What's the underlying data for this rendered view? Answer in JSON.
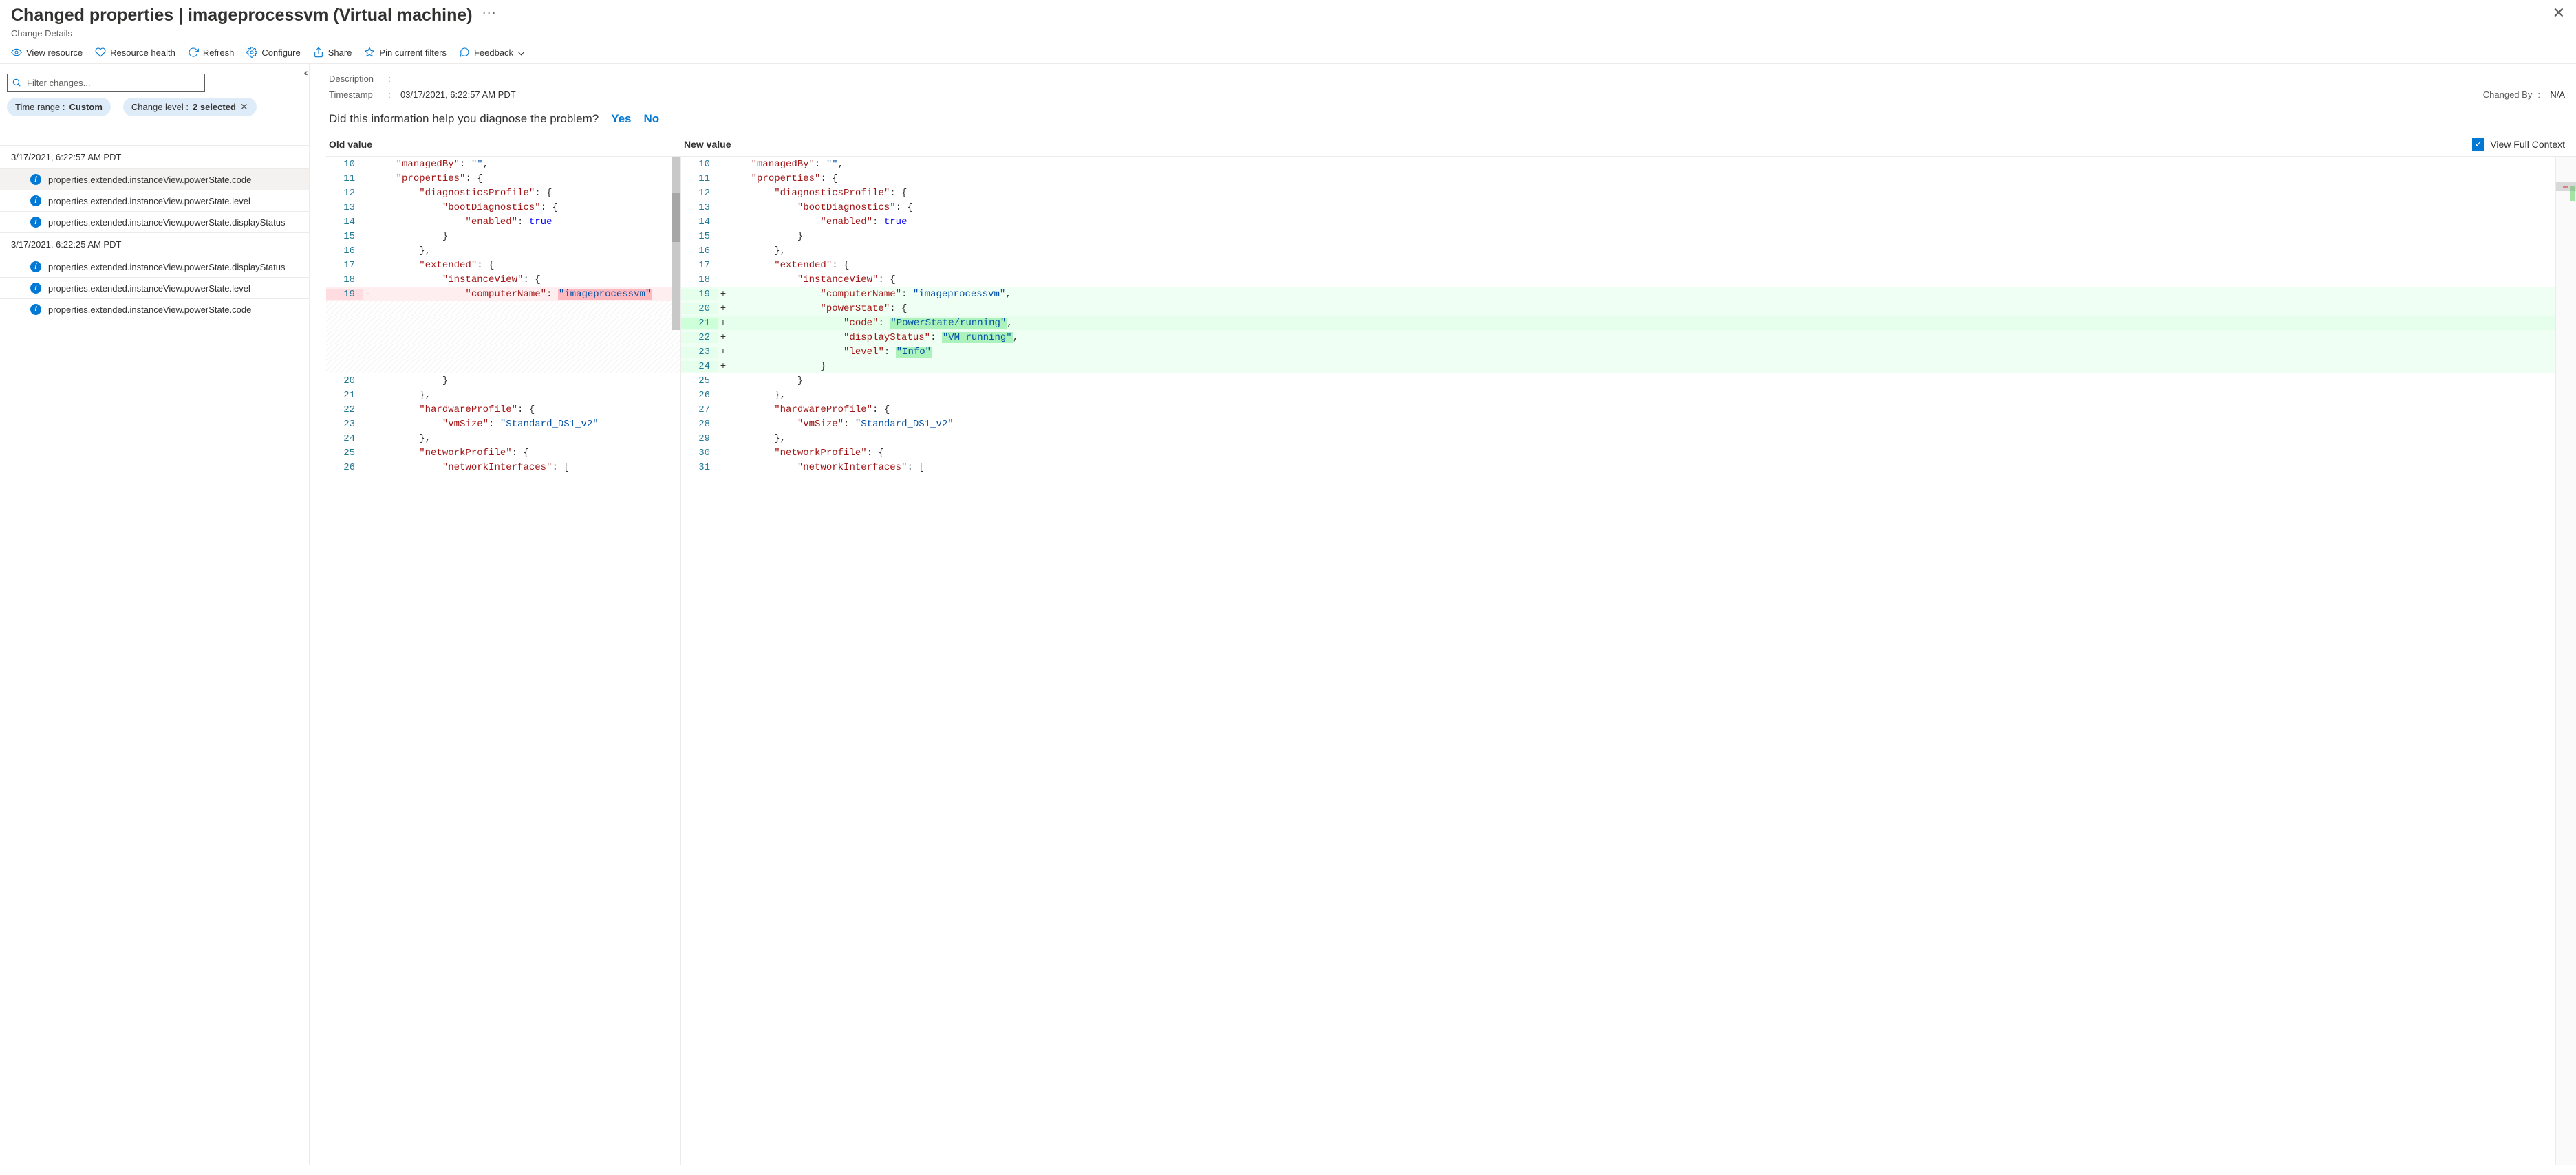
{
  "header": {
    "title": "Changed properties | imageprocessvm (Virtual machine)",
    "subtitle": "Change Details"
  },
  "toolbar": {
    "view_resource": "View resource",
    "resource_health": "Resource health",
    "refresh": "Refresh",
    "configure": "Configure",
    "share": "Share",
    "pin": "Pin current filters",
    "feedback": "Feedback"
  },
  "filter": {
    "placeholder": "Filter changes...",
    "time_range_label": "Time range : ",
    "time_range_value": "Custom",
    "change_level_label": "Change level : ",
    "change_level_value": "2 selected"
  },
  "groups": [
    {
      "timestamp": "3/17/2021, 6:22:57 AM PDT",
      "items": [
        {
          "path": "properties.extended.instanceView.powerState.code",
          "selected": true
        },
        {
          "path": "properties.extended.instanceView.powerState.level",
          "selected": false
        },
        {
          "path": "properties.extended.instanceView.powerState.displayStatus",
          "selected": false
        }
      ]
    },
    {
      "timestamp": "3/17/2021, 6:22:25 AM PDT",
      "items": [
        {
          "path": "properties.extended.instanceView.powerState.displayStatus",
          "selected": false
        },
        {
          "path": "properties.extended.instanceView.powerState.level",
          "selected": false
        },
        {
          "path": "properties.extended.instanceView.powerState.code",
          "selected": false
        }
      ]
    }
  ],
  "meta": {
    "description_label": "Description",
    "description_value": "",
    "timestamp_label": "Timestamp",
    "timestamp_value": "03/17/2021, 6:22:57 AM PDT",
    "changed_by_label": "Changed By",
    "changed_by_value": "N/A"
  },
  "prompt": {
    "question": "Did this information help you diagnose the problem?",
    "yes": "Yes",
    "no": "No"
  },
  "diff": {
    "old_label": "Old value",
    "new_label": "New value",
    "full_context_label": "View Full Context",
    "old_lines": [
      {
        "n": 10,
        "type": "normal",
        "tokens": [
          [
            "p",
            "    "
          ],
          [
            "k",
            "\"managedBy\""
          ],
          [
            "p",
            ": "
          ],
          [
            "s",
            "\"\""
          ],
          [
            "p",
            ","
          ]
        ]
      },
      {
        "n": 11,
        "type": "normal",
        "tokens": [
          [
            "p",
            "    "
          ],
          [
            "k",
            "\"properties\""
          ],
          [
            "p",
            ": {"
          ]
        ]
      },
      {
        "n": 12,
        "type": "normal",
        "tokens": [
          [
            "p",
            "        "
          ],
          [
            "k",
            "\"diagnosticsProfile\""
          ],
          [
            "p",
            ": {"
          ]
        ]
      },
      {
        "n": 13,
        "type": "normal",
        "tokens": [
          [
            "p",
            "            "
          ],
          [
            "k",
            "\"bootDiagnostics\""
          ],
          [
            "p",
            ": {"
          ]
        ]
      },
      {
        "n": 14,
        "type": "normal",
        "tokens": [
          [
            "p",
            "                "
          ],
          [
            "k",
            "\"enabled\""
          ],
          [
            "p",
            ": "
          ],
          [
            "b",
            "true"
          ]
        ]
      },
      {
        "n": 15,
        "type": "normal",
        "tokens": [
          [
            "p",
            "            }"
          ]
        ]
      },
      {
        "n": 16,
        "type": "normal",
        "tokens": [
          [
            "p",
            "        },"
          ]
        ]
      },
      {
        "n": 17,
        "type": "normal",
        "tokens": [
          [
            "p",
            "        "
          ],
          [
            "k",
            "\"extended\""
          ],
          [
            "p",
            ": {"
          ]
        ]
      },
      {
        "n": 18,
        "type": "normal",
        "tokens": [
          [
            "p",
            "            "
          ],
          [
            "k",
            "\"instanceView\""
          ],
          [
            "p",
            ": {"
          ]
        ]
      },
      {
        "n": 19,
        "type": "removed",
        "marker": "-",
        "tokens": [
          [
            "p",
            "                "
          ],
          [
            "k",
            "\"computerName\""
          ],
          [
            "p",
            ": "
          ],
          [
            "sh",
            "\"imageprocessvm\""
          ]
        ]
      },
      {
        "n": "",
        "type": "dim",
        "tokens": []
      },
      {
        "n": "",
        "type": "dim",
        "tokens": []
      },
      {
        "n": "",
        "type": "dim",
        "tokens": []
      },
      {
        "n": "",
        "type": "dim",
        "tokens": []
      },
      {
        "n": "",
        "type": "dim",
        "tokens": []
      },
      {
        "n": 20,
        "type": "normal",
        "tokens": [
          [
            "p",
            "            }"
          ]
        ]
      },
      {
        "n": 21,
        "type": "normal",
        "tokens": [
          [
            "p",
            "        },"
          ]
        ]
      },
      {
        "n": 22,
        "type": "normal",
        "tokens": [
          [
            "p",
            "        "
          ],
          [
            "k",
            "\"hardwareProfile\""
          ],
          [
            "p",
            ": {"
          ]
        ]
      },
      {
        "n": 23,
        "type": "normal",
        "tokens": [
          [
            "p",
            "            "
          ],
          [
            "k",
            "\"vmSize\""
          ],
          [
            "p",
            ": "
          ],
          [
            "s",
            "\"Standard_DS1_v2\""
          ]
        ]
      },
      {
        "n": 24,
        "type": "normal",
        "tokens": [
          [
            "p",
            "        },"
          ]
        ]
      },
      {
        "n": 25,
        "type": "normal",
        "tokens": [
          [
            "p",
            "        "
          ],
          [
            "k",
            "\"networkProfile\""
          ],
          [
            "p",
            ": {"
          ]
        ]
      },
      {
        "n": 26,
        "type": "normal",
        "tokens": [
          [
            "p",
            "            "
          ],
          [
            "k",
            "\"networkInterfaces\""
          ],
          [
            "p",
            ": ["
          ]
        ]
      }
    ],
    "new_lines": [
      {
        "n": 10,
        "type": "normal",
        "tokens": [
          [
            "p",
            "    "
          ],
          [
            "k",
            "\"managedBy\""
          ],
          [
            "p",
            ": "
          ],
          [
            "s",
            "\"\""
          ],
          [
            "p",
            ","
          ]
        ]
      },
      {
        "n": 11,
        "type": "normal",
        "tokens": [
          [
            "p",
            "    "
          ],
          [
            "k",
            "\"properties\""
          ],
          [
            "p",
            ": {"
          ]
        ]
      },
      {
        "n": 12,
        "type": "normal",
        "tokens": [
          [
            "p",
            "        "
          ],
          [
            "k",
            "\"diagnosticsProfile\""
          ],
          [
            "p",
            ": {"
          ]
        ]
      },
      {
        "n": 13,
        "type": "normal",
        "tokens": [
          [
            "p",
            "            "
          ],
          [
            "k",
            "\"bootDiagnostics\""
          ],
          [
            "p",
            ": {"
          ]
        ]
      },
      {
        "n": 14,
        "type": "normal",
        "tokens": [
          [
            "p",
            "                "
          ],
          [
            "k",
            "\"enabled\""
          ],
          [
            "p",
            ": "
          ],
          [
            "b",
            "true"
          ]
        ]
      },
      {
        "n": 15,
        "type": "normal",
        "tokens": [
          [
            "p",
            "            }"
          ]
        ]
      },
      {
        "n": 16,
        "type": "normal",
        "tokens": [
          [
            "p",
            "        },"
          ]
        ]
      },
      {
        "n": 17,
        "type": "normal",
        "tokens": [
          [
            "p",
            "        "
          ],
          [
            "k",
            "\"extended\""
          ],
          [
            "p",
            ": {"
          ]
        ]
      },
      {
        "n": 18,
        "type": "normal",
        "tokens": [
          [
            "p",
            "            "
          ],
          [
            "k",
            "\"instanceView\""
          ],
          [
            "p",
            ": {"
          ]
        ]
      },
      {
        "n": 19,
        "type": "added-light",
        "marker": "+",
        "tokens": [
          [
            "p",
            "                "
          ],
          [
            "k",
            "\"computerName\""
          ],
          [
            "p",
            ": "
          ],
          [
            "s",
            "\"imageprocessvm\""
          ],
          [
            "p",
            ","
          ]
        ]
      },
      {
        "n": 20,
        "type": "added-light",
        "marker": "+",
        "tokens": [
          [
            "p",
            "                "
          ],
          [
            "k",
            "\"powerState\""
          ],
          [
            "p",
            ": {"
          ]
        ]
      },
      {
        "n": 21,
        "type": "added",
        "marker": "+",
        "tokens": [
          [
            "p",
            "                    "
          ],
          [
            "k",
            "\"code\""
          ],
          [
            "p",
            ": "
          ],
          [
            "sh",
            "\"PowerState/running\""
          ],
          [
            "p",
            ","
          ]
        ]
      },
      {
        "n": 22,
        "type": "added-light",
        "marker": "+",
        "tokens": [
          [
            "p",
            "                    "
          ],
          [
            "k",
            "\"displayStatus\""
          ],
          [
            "p",
            ": "
          ],
          [
            "sh",
            "\"VM running\""
          ],
          [
            "p",
            ","
          ]
        ]
      },
      {
        "n": 23,
        "type": "added-light",
        "marker": "+",
        "tokens": [
          [
            "p",
            "                    "
          ],
          [
            "k",
            "\"level\""
          ],
          [
            "p",
            ": "
          ],
          [
            "sh",
            "\"Info\""
          ]
        ]
      },
      {
        "n": 24,
        "type": "added-light",
        "marker": "+",
        "tokens": [
          [
            "p",
            "                }"
          ]
        ]
      },
      {
        "n": 25,
        "type": "normal",
        "tokens": [
          [
            "p",
            "            }"
          ]
        ]
      },
      {
        "n": 26,
        "type": "normal",
        "tokens": [
          [
            "p",
            "        },"
          ]
        ]
      },
      {
        "n": 27,
        "type": "normal",
        "tokens": [
          [
            "p",
            "        "
          ],
          [
            "k",
            "\"hardwareProfile\""
          ],
          [
            "p",
            ": {"
          ]
        ]
      },
      {
        "n": 28,
        "type": "normal",
        "tokens": [
          [
            "p",
            "            "
          ],
          [
            "k",
            "\"vmSize\""
          ],
          [
            "p",
            ": "
          ],
          [
            "s",
            "\"Standard_DS1_v2\""
          ]
        ]
      },
      {
        "n": 29,
        "type": "normal",
        "tokens": [
          [
            "p",
            "        },"
          ]
        ]
      },
      {
        "n": 30,
        "type": "normal",
        "tokens": [
          [
            "p",
            "        "
          ],
          [
            "k",
            "\"networkProfile\""
          ],
          [
            "p",
            ": {"
          ]
        ]
      },
      {
        "n": 31,
        "type": "normal",
        "tokens": [
          [
            "p",
            "            "
          ],
          [
            "k",
            "\"networkInterfaces\""
          ],
          [
            "p",
            ": ["
          ]
        ]
      }
    ]
  }
}
